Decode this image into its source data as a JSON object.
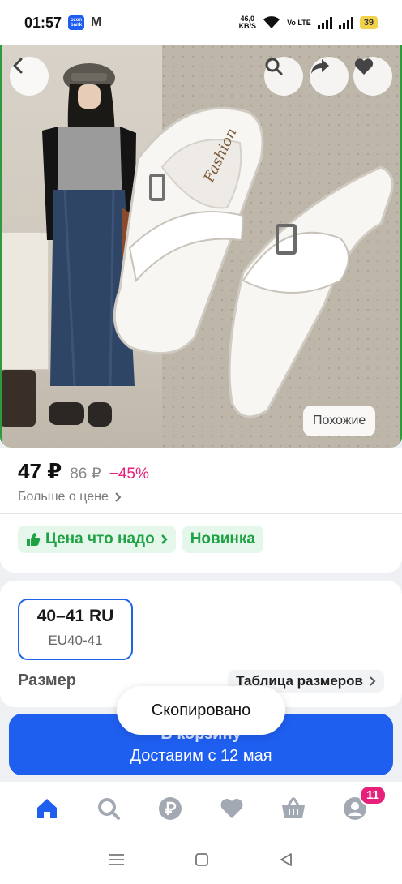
{
  "status_bar": {
    "time": "01:57",
    "app_badge_text": "ozon bank",
    "net_speed": "46,0",
    "net_unit": "KB/S",
    "volte": "Vo LTE",
    "battery": "39"
  },
  "photo": {
    "brand_on_insole": "Fashion",
    "similar_label": "Похожие"
  },
  "price": {
    "current": "47 ₽",
    "old": "86 ₽",
    "discount": "−45%",
    "more_label": "Больше о цене"
  },
  "badges": [
    {
      "label": "Цена что надо"
    },
    {
      "label": "Новинка"
    }
  ],
  "size": {
    "selected_ru": "40–41 RU",
    "selected_eu": "EU40-41",
    "label": "Размер",
    "table_label": "Таблица размеров"
  },
  "cart": {
    "label": "В корзину",
    "delivery": "Доставим с 12 мая"
  },
  "toast": {
    "text": "Скопировано"
  },
  "bottom_nav": {
    "items": [
      {
        "name": "home",
        "icon": "home-icon",
        "active": true
      },
      {
        "name": "search",
        "icon": "search-icon"
      },
      {
        "name": "bank",
        "icon": "ruble-icon"
      },
      {
        "name": "favorites",
        "icon": "heart-icon"
      },
      {
        "name": "cart",
        "icon": "basket-icon"
      },
      {
        "name": "profile",
        "icon": "profile-icon",
        "badge": "11"
      }
    ]
  },
  "colors": {
    "accent": "#1f5ff0",
    "discount": "#e7207c",
    "badge_green": "#1fa246"
  }
}
